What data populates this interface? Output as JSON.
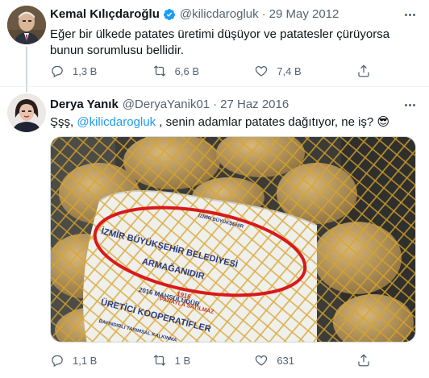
{
  "tweet1": {
    "name": "Kemal Kılıçdaroğlu",
    "handle": "@kilicdarogluk",
    "separator": "·",
    "date": "29 May 2012",
    "text": "Eğer bir ülkede patates üretimi düşüyor ve patatesler çürüyorsa bunun sorumlusu bellidir.",
    "replies": "1,3 B",
    "retweets": "6,6 B",
    "likes": "7,4 B",
    "verified_color": "#1d9bf0"
  },
  "tweet2": {
    "name": "Derya Yanık",
    "handle": "@DeryaYanik01",
    "separator": "·",
    "date": "27 Haz 2016",
    "text_before": "Şşş, ",
    "mention": "@kilicdarogluk",
    "text_after": " , senin adamlar patates dağıtıyor, ne iş? 😎",
    "replies": "1,1 B",
    "retweets": "1 B",
    "likes": "631"
  },
  "image": {
    "bag_line1": "İZMİR BÜYÜKŞEHİR BELEDİYESİ",
    "bag_line2": "ARMAĞANIDIR",
    "bag_line3": "1916",
    "bag_line4": "2016 MAHSULÜDÜR",
    "bag_line5": "PARAYLA SATILMAZ",
    "bag_line6": "ÜRETİCİ KOOPERATİFLER",
    "bag_line7": "BAYINDIRLI TARIMSAL KALKINMA",
    "bag_logo": "İZMİR BÜYÜKŞEHİR"
  },
  "colors": {
    "accent": "#1d9bf0",
    "muted": "#536471",
    "text": "#0f1419",
    "circle": "#d81a1a"
  }
}
